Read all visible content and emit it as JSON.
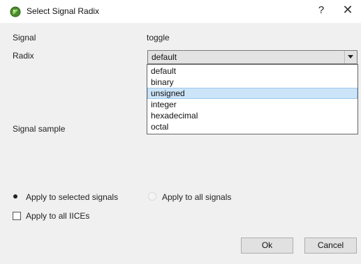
{
  "window": {
    "title": "Select Signal Radix",
    "help_label": "?",
    "close_label": "✕"
  },
  "form": {
    "signal_label": "Signal",
    "signal_value": "toggle",
    "radix_label": "Radix",
    "radix_selected": "default",
    "radix_options": [
      "default",
      "binary",
      "unsigned",
      "integer",
      "hexadecimal",
      "octal"
    ],
    "radix_highlighted_index": 2,
    "signal_sample_label": "Signal sample"
  },
  "apply": {
    "selected_label": "Apply to selected signals",
    "selected_checked": true,
    "all_label": "Apply to all signals",
    "all_checked": false,
    "iices_label": "Apply to all IICEs",
    "iices_checked": false
  },
  "buttons": {
    "ok_label": "Ok",
    "cancel_label": "Cancel"
  },
  "colors": {
    "highlight": "#cce4f7",
    "icon_green": "#4a8a2a"
  }
}
